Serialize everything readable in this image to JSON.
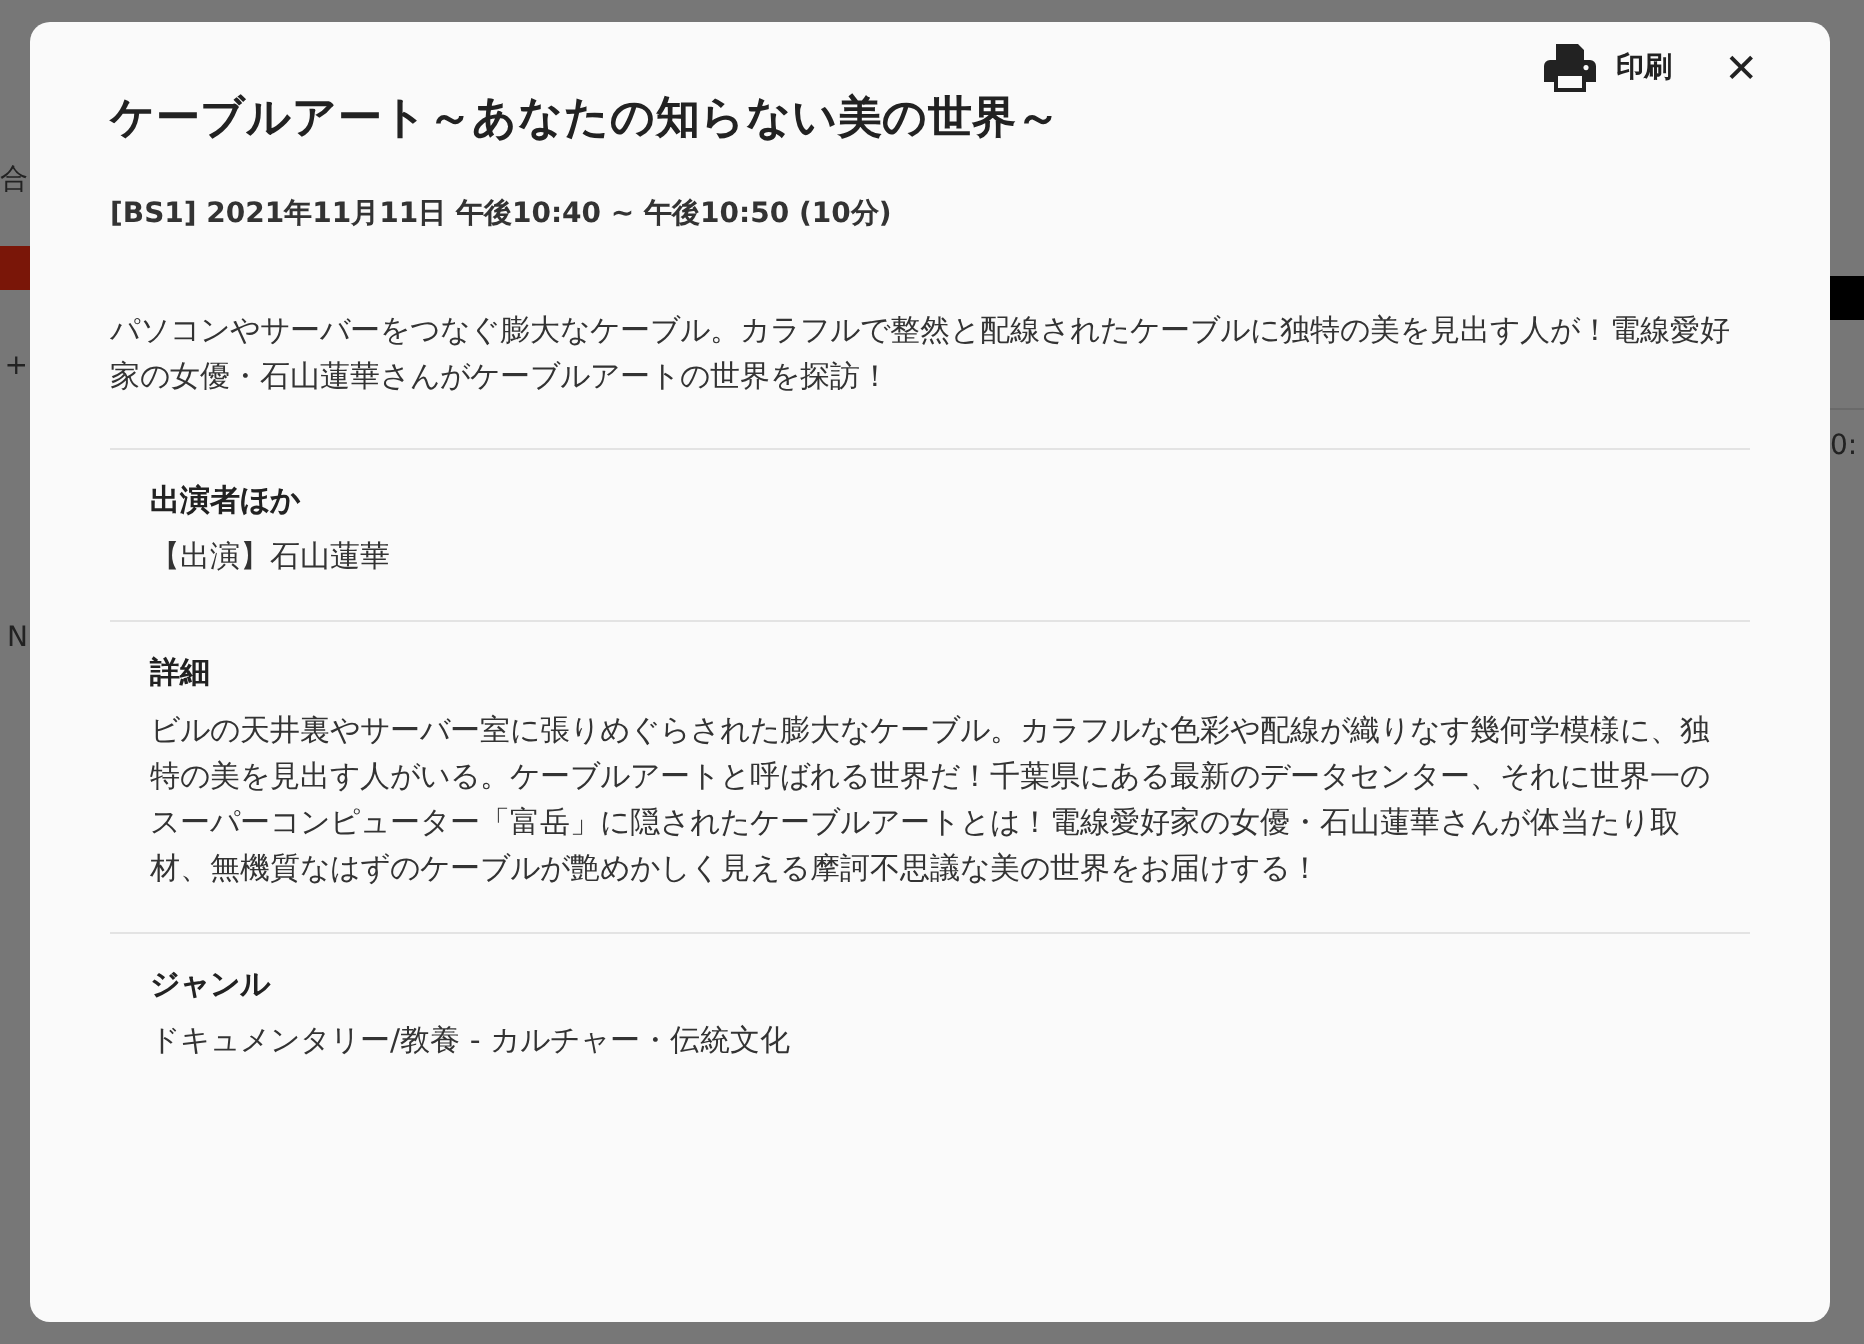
{
  "background": {
    "left_fragments": [
      "合",
      "+",
      "N"
    ],
    "right_fragments": [
      "0:"
    ]
  },
  "dialog": {
    "print_label": "印刷",
    "close_label": "✕",
    "title": "ケーブルアート～あなたの知らない美の世界～",
    "schedule": "[BS1] 2021年11月11日 午後10:40 ~ 午後10:50 (10分)",
    "description": "パソコンやサーバーをつなぐ膨大なケーブル。カラフルで整然と配線されたケーブルに独特の美を見出す人が！電線愛好家の女優・石山蓮華さんがケーブルアートの世界を探訪！",
    "sections": [
      {
        "heading": "出演者ほか",
        "body": "【出演】石山蓮華"
      },
      {
        "heading": "詳細",
        "body": "ビルの天井裏やサーバー室に張りめぐらされた膨大なケーブル。カラフルな色彩や配線が織りなす幾何学模様に、独特の美を見出す人がいる。ケーブルアートと呼ばれる世界だ！千葉県にある最新のデータセンター、それに世界一のスーパーコンピューター「富岳」に隠されたケーブルアートとは！電線愛好家の女優・石山蓮華さんが体当たり取材、無機質なはずのケーブルが艶めかしく見える摩訶不思議な美の世界をお届けする！"
      },
      {
        "heading": "ジャンル",
        "body": "ドキュメンタリー/教養 - カルチャー・伝統文化"
      }
    ]
  }
}
